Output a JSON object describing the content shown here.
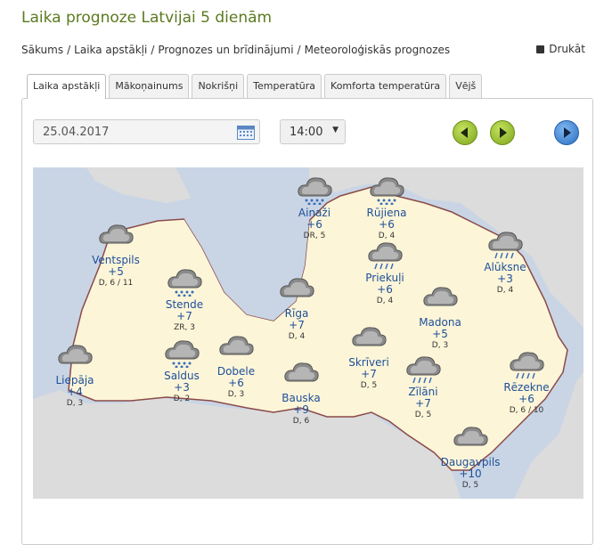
{
  "title": "Laika prognoze Latvijai 5 dienām",
  "breadcrumb": [
    "Sākums",
    "Laika apstākļi",
    "Prognozes un brīdinājumi",
    "Meteoroloģiskās prognozes"
  ],
  "print_label": "Drukāt",
  "tabs": [
    "Laika apstākļi",
    "Mākoņainums",
    "Nokrišņi",
    "Temperatūra",
    "Komforta temperatūra",
    "Vējš"
  ],
  "date_value": "25.04.2017",
  "time_value": "14:00",
  "cities": [
    {
      "name": "Ainaži",
      "temp": "+6",
      "wind": "DR, 5",
      "icon": "cloud-snow-icon"
    },
    {
      "name": "Rūjiena",
      "temp": "+6",
      "wind": "D, 4",
      "icon": "cloud-snow-icon"
    },
    {
      "name": "Ventspils",
      "temp": "+5",
      "wind": "D, 6 / 11",
      "icon": "cloud-icon"
    },
    {
      "name": "Stende",
      "temp": "+7",
      "wind": "ZR, 3",
      "icon": "cloud-snow-icon"
    },
    {
      "name": "Rīga",
      "temp": "+7",
      "wind": "D, 4",
      "icon": "cloud-icon"
    },
    {
      "name": "Priekuļi",
      "temp": "+6",
      "wind": "D, 4",
      "icon": "cloud-rain-icon"
    },
    {
      "name": "Alūksne",
      "temp": "+3",
      "wind": "D, 4",
      "icon": "cloud-rain-icon"
    },
    {
      "name": "Madona",
      "temp": "+5",
      "wind": "D, 3",
      "icon": "cloud-icon"
    },
    {
      "name": "Liepāja",
      "temp": "+4",
      "wind": "D, 3",
      "icon": "cloud-icon"
    },
    {
      "name": "Saldus",
      "temp": "+3",
      "wind": "D, 2",
      "icon": "cloud-snow-icon"
    },
    {
      "name": "Dobele",
      "temp": "+6",
      "wind": "D, 3",
      "icon": "cloud-icon"
    },
    {
      "name": "Skrīveri",
      "temp": "+7",
      "wind": "D, 5",
      "icon": "cloud-icon"
    },
    {
      "name": "Bauska",
      "temp": "+9",
      "wind": "D, 6",
      "icon": "cloud-icon"
    },
    {
      "name": "Zīlāni",
      "temp": "+7",
      "wind": "D, 5",
      "icon": "cloud-rain-icon"
    },
    {
      "name": "Rēzekne",
      "temp": "+6",
      "wind": "D, 6 / 10",
      "icon": "cloud-rain-icon"
    },
    {
      "name": "Daugavpils",
      "temp": "+10",
      "wind": "D, 5",
      "icon": "cloud-icon"
    }
  ]
}
